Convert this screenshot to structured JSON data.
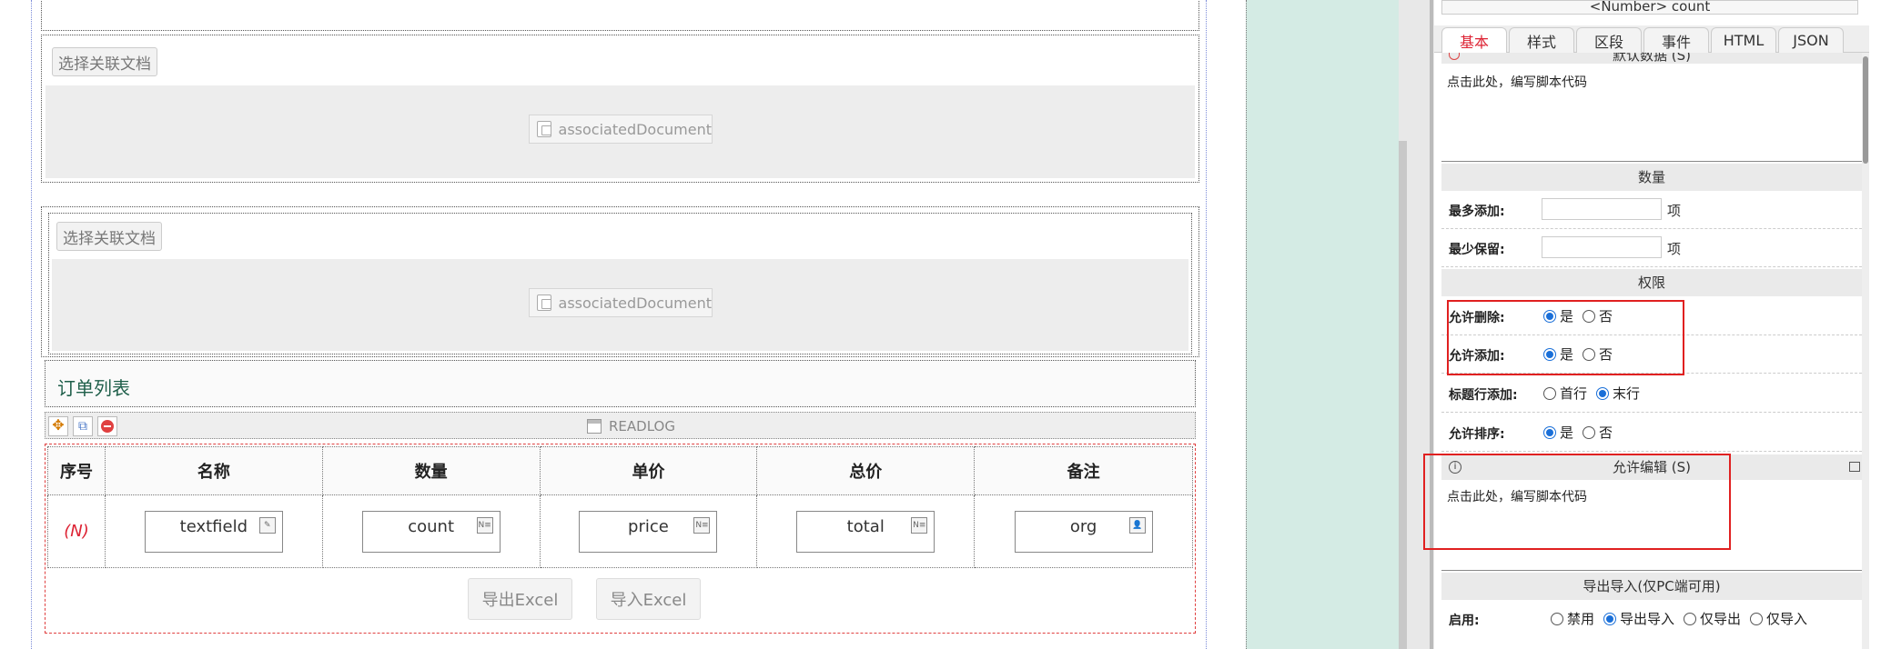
{
  "canvas": {
    "assoc_button_1": "选择关联文档",
    "assoc_button_2": "选择关联文档",
    "assoc_chip_1": "associatedDocument",
    "assoc_chip_2": "associatedDocument",
    "section_title": "订单列表",
    "readlog_label": "READLOG",
    "table": {
      "headers": [
        "序号",
        "名称",
        "数量",
        "单价",
        "总价",
        "备注"
      ],
      "row_index": "(N)",
      "cells": [
        "textfield",
        "count",
        "price",
        "total",
        "org"
      ]
    },
    "export_button": "导出Excel",
    "import_button": "导入Excel"
  },
  "panel": {
    "top_value": "<Number> count",
    "tabs": [
      "基本",
      "样式",
      "区段",
      "事件",
      "HTML",
      "JSON"
    ],
    "active_tab": "基本",
    "default_data_head": "默认数据 (S)",
    "script_placeholder_1": "点击此处，编写脚本代码",
    "quantity_head": "数量",
    "max_add_label": "最多添加:",
    "min_keep_label": "最少保留:",
    "unit": "项",
    "perm_head": "权限",
    "allow_delete_label": "允许删除:",
    "allow_add_label": "允许添加:",
    "title_add_label": "标题行添加:",
    "allow_sort_label": "允许排序:",
    "yes": "是",
    "no": "否",
    "first_row": "首行",
    "last_row": "末行",
    "allow_edit_head": "允许编辑 (S)",
    "script_placeholder_2": "点击此处，编写脚本代码",
    "export_head": "导出导入(仅PC端可用)",
    "enable_label": "启用:",
    "enable_opts": [
      "禁用",
      "导出导入",
      "仅导出",
      "仅导入"
    ]
  }
}
